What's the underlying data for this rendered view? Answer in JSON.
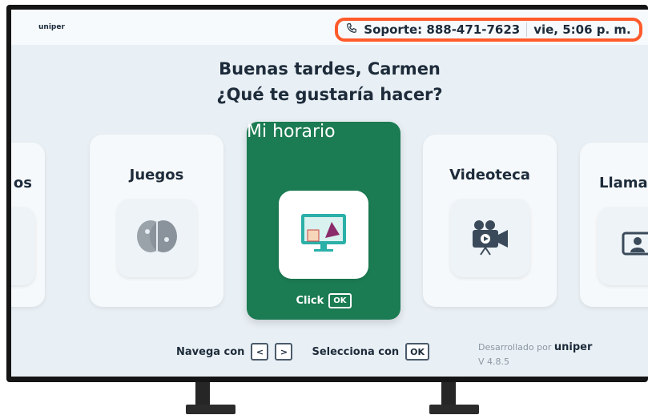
{
  "header": {
    "logo": "uniper",
    "support_label": "Soporte: 888-471-7623",
    "datetime": "vie, 5:06 p. m."
  },
  "greeting": {
    "line1": "Buenas tardes, Carmen",
    "line2": "¿Qué te gustaría hacer?"
  },
  "cards": {
    "left_partial": "os",
    "games": "Juegos",
    "schedule": "Mi horario",
    "video": "Videoteca",
    "calls_partial": "Llama"
  },
  "active_card": {
    "click_label": "Click",
    "ok_label": "OK"
  },
  "bottom": {
    "navigate_label": "Navega con",
    "left_key": "<",
    "right_key": ">",
    "select_label": "Selecciona con",
    "ok_key": "OK",
    "developed_by": "Desarrollado por",
    "developed_logo": "uniper",
    "version": "V 4.8.5"
  },
  "colors": {
    "active_card": "#1b7b52",
    "highlight": "#ff5a2b"
  }
}
